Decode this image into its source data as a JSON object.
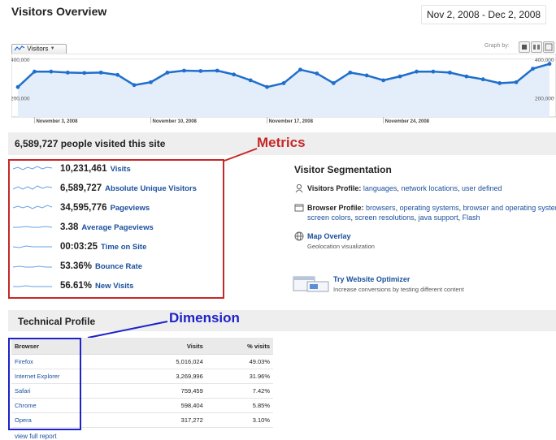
{
  "header": {
    "title": "Visitors Overview",
    "date_range": "Nov 2, 2008 - Dec 2, 2008"
  },
  "graph_controls": {
    "metric_dropdown": "Visitors",
    "graph_by_label": "Graph by:"
  },
  "chart_data": {
    "type": "area",
    "series": [
      {
        "values": [
          255000,
          335000,
          335000,
          330000,
          328000,
          330000,
          318000,
          265000,
          280000,
          330000,
          340000,
          338000,
          340000,
          320000,
          290000,
          255000,
          275000,
          345000,
          325000,
          275000,
          330000,
          315000,
          290000,
          310000,
          335000,
          335000,
          330000,
          310000,
          295000,
          275000,
          280000,
          350000,
          375000
        ]
      }
    ],
    "y_ticks": [
      "400,000",
      "200,000"
    ],
    "ylim": [
      100000,
      420000
    ],
    "x_labels": [
      "November 3, 2008",
      "November 10, 2008",
      "November 17, 2008",
      "November 24, 2008"
    ],
    "x_label_index": [
      1,
      8,
      15,
      22
    ],
    "grid": true,
    "color": "#1e6fcc"
  },
  "summary": {
    "text": "6,589,727 people visited this site"
  },
  "metrics_callout": "Metrics",
  "metrics": [
    {
      "value": "10,231,461",
      "label": "Visits"
    },
    {
      "value": "6,589,727",
      "label": "Absolute Unique Visitors"
    },
    {
      "value": "34,595,776",
      "label": "Pageviews"
    },
    {
      "value": "3.38",
      "label": "Average Pageviews"
    },
    {
      "value": "00:03:25",
      "label": "Time on Site"
    },
    {
      "value": "53.36%",
      "label": "Bounce Rate"
    },
    {
      "value": "56.61%",
      "label": "New Visits"
    }
  ],
  "segmentation": {
    "title": "Visitor Segmentation",
    "visitors_profile_label": "Visitors Profile:",
    "visitors_profile_links": [
      "languages",
      "network locations",
      "user defined"
    ],
    "browser_profile_label": "Browser Profile:",
    "browser_profile_links": [
      "browsers",
      "operating systems",
      "browser and operating systems",
      "screen colors",
      "screen resolutions",
      "java support",
      "Flash"
    ],
    "map_overlay": "Map Overlay",
    "map_overlay_sub": "Geolocation visualization",
    "optimizer": "Try Website Optimizer",
    "optimizer_sub": "Increase conversions by testing different content"
  },
  "technical_profile": {
    "title": "Technical Profile",
    "dimension_callout": "Dimension",
    "headers": [
      "Browser",
      "Visits",
      "% visits"
    ],
    "rows": [
      [
        "Firefox",
        "5,016,024",
        "49.03%"
      ],
      [
        "Internet Explorer",
        "3,269,996",
        "31.96%"
      ],
      [
        "Safari",
        "759,459",
        "7.42%"
      ],
      [
        "Chrome",
        "598,404",
        "5.85%"
      ],
      [
        "Opera",
        "317,272",
        "3.10%"
      ]
    ],
    "view_full": "view full report"
  }
}
